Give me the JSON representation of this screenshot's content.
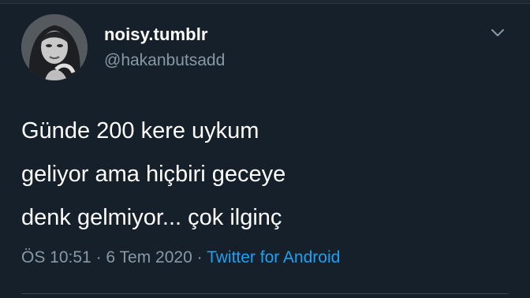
{
  "tweet": {
    "display_name": "noisy.tumblr",
    "handle": "@hakanbutsadd",
    "text": "Günde 200 kere uykum\ngeliyor ama hiçbiri geceye\ndenk gelmiyor... çok ilginç",
    "time": "ÖS 10:51",
    "separator": " · ",
    "date": "6 Tem 2020",
    "separator2": " · ",
    "source": "Twitter for Android",
    "menu_icon": "chevron-down-icon",
    "avatar_icon": "avatar"
  },
  "colors": {
    "background": "#15202b",
    "primary_text": "#ffffff",
    "secondary_text": "#8899a6",
    "link": "#1da1f2",
    "divider": "#38444d"
  }
}
